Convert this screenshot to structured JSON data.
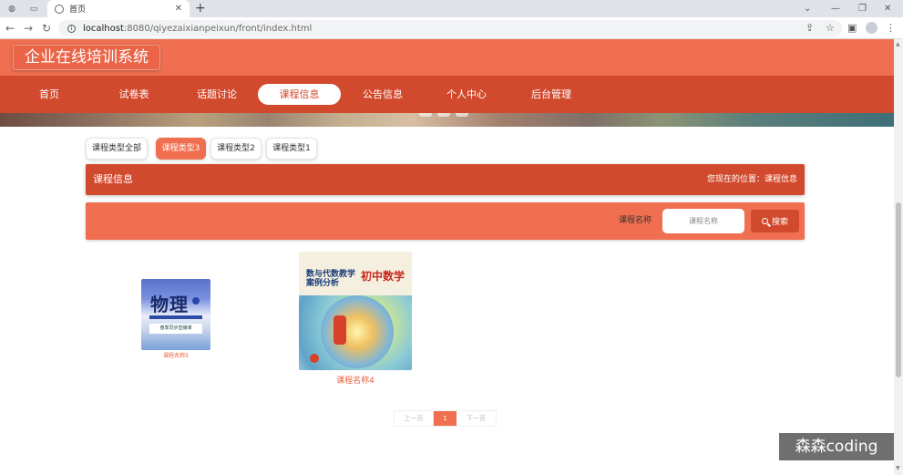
{
  "browser": {
    "tab_title": "首页",
    "url_host": "localhost",
    "url_path": ":8080/qiyezaixianpeixun/front/index.html"
  },
  "site": {
    "title": "企业在线培训系统"
  },
  "nav": {
    "items": [
      {
        "label": "首页"
      },
      {
        "label": "试卷表"
      },
      {
        "label": "话题讨论"
      },
      {
        "label": "课程信息"
      },
      {
        "label": "公告信息"
      },
      {
        "label": "个人中心"
      },
      {
        "label": "后台管理"
      }
    ],
    "active": "课程信息"
  },
  "categories": {
    "items": [
      {
        "label": "课程类型全部"
      },
      {
        "label": "课程类型3"
      },
      {
        "label": "课程类型2"
      },
      {
        "label": "课程类型1"
      }
    ],
    "active": "课程类型3"
  },
  "section": {
    "title": "课程信息",
    "breadcrumb": "您现在的位置：课程信息"
  },
  "search": {
    "label": "课程名称",
    "placeholder": "课程名称",
    "button_label": "搜索"
  },
  "courses": [
    {
      "name": "课程名称5",
      "cover_text": "物理",
      "cover_subtext": "春季同步直播课"
    },
    {
      "name": "课程名称4",
      "cover_text": "初中数学",
      "cover_subtext": "数与代数教学案例分析"
    }
  ],
  "pagination": {
    "prev": "上一页",
    "current": "1",
    "next": "下一页"
  },
  "watermark": "森森coding",
  "colors": {
    "header": "#ef6f50",
    "nav": "#d24a2e",
    "accent": "#e8603f"
  }
}
